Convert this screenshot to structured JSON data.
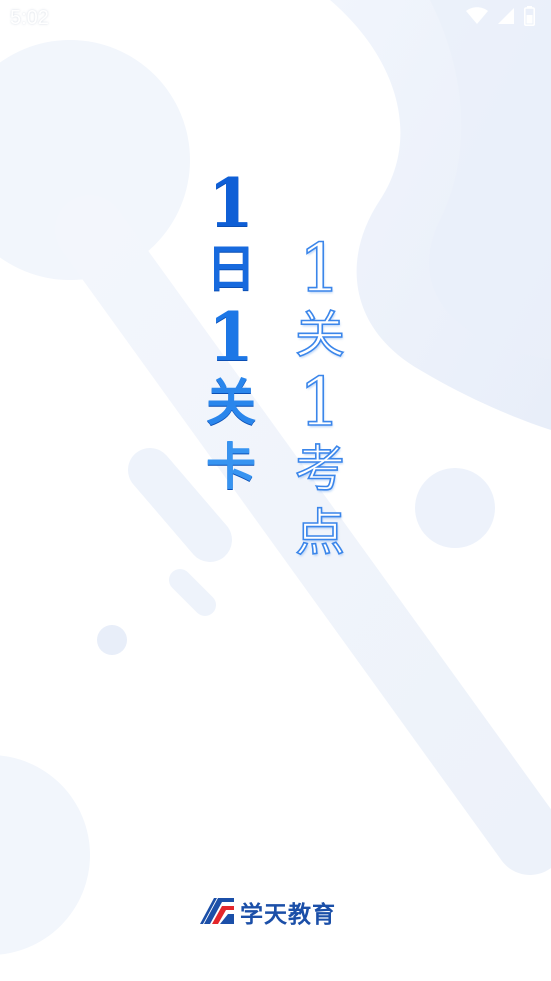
{
  "status_bar": {
    "time": "5:02"
  },
  "slogan": {
    "left_column": [
      "1",
      "日",
      "1",
      "关",
      "卡"
    ],
    "right_column": [
      "1",
      "关",
      "1",
      "考",
      "点"
    ]
  },
  "brand": {
    "name": "学天教育"
  },
  "colors": {
    "primary_blue": "#1a6fe0",
    "brand_navy": "#1b4fa8",
    "brand_red": "#e3262b",
    "background": "#ffffff"
  },
  "icons": {
    "status_notification": "notification-icon",
    "status_wifi": "wifi-icon",
    "status_signal": "signal-icon",
    "status_battery": "battery-icon",
    "brand_logo": "xuetian-logo-icon"
  }
}
